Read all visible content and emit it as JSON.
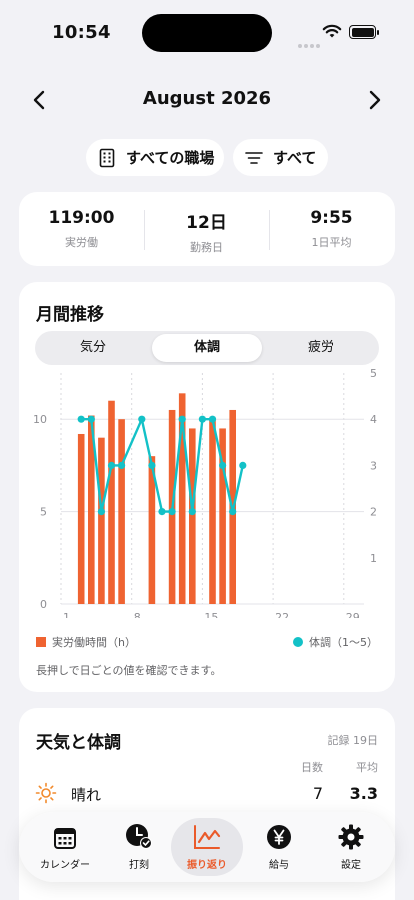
{
  "status": {
    "time": "10:54"
  },
  "header": {
    "month": "August 2026"
  },
  "filters": {
    "workplace": "すべての職場",
    "category": "すべて"
  },
  "summary": [
    {
      "value": "119:00",
      "label": "実労働"
    },
    {
      "value": "12日",
      "label": "勤務日"
    },
    {
      "value": "9:55",
      "label": "1日平均"
    }
  ],
  "trend": {
    "title": "月間推移",
    "segments": [
      "気分",
      "体調",
      "疲労"
    ],
    "selected_segment": "体調",
    "legend_hours": "実労働時間（h）",
    "legend_condition": "体調（1〜5）",
    "hint": "長押しで日ごとの値を確認できます。"
  },
  "colors": {
    "accent": "#ea5a2a",
    "bar": "#ef6331",
    "line": "#13c1c7"
  },
  "chart_data": {
    "type": "bar+line",
    "x": [
      3,
      4,
      5,
      6,
      7,
      9,
      10,
      11,
      12,
      13,
      14,
      15,
      16,
      17,
      18,
      19
    ],
    "x_ticks": [
      "1",
      "8",
      "15",
      "22",
      "29"
    ],
    "xlim": [
      1,
      31
    ],
    "series": [
      {
        "name": "実労働時間（h）",
        "type": "bar",
        "axis": "left",
        "values": [
          9.2,
          10.2,
          9.0,
          11.0,
          10.0,
          null,
          8.0,
          null,
          10.5,
          11.4,
          9.5,
          null,
          10.0,
          9.5,
          10.5,
          null
        ]
      },
      {
        "name": "体調（1〜5）",
        "type": "line",
        "axis": "right",
        "values": [
          4,
          4,
          2,
          3,
          3,
          4,
          3,
          2,
          2,
          4,
          2,
          4,
          4,
          3,
          2,
          3
        ]
      }
    ],
    "left_axis": {
      "ylim": [
        0,
        12.5
      ],
      "ticks": [
        "0",
        "5",
        "10"
      ]
    },
    "right_axis": {
      "ylim": [
        0,
        5
      ],
      "ticks": [
        "1",
        "2",
        "3",
        "4",
        "5"
      ]
    }
  },
  "weather": {
    "title": "天気と体調",
    "records": "記録 19日",
    "col_days": "日数",
    "col_avg": "平均",
    "rows": [
      {
        "icon": "sun-icon",
        "name": "晴れ",
        "days": "7",
        "avg": "3.3"
      }
    ]
  },
  "tabs": [
    {
      "icon": "calendar-icon",
      "label": "カレンダー"
    },
    {
      "icon": "clock-check-icon",
      "label": "打刻"
    },
    {
      "icon": "chart-line-icon",
      "label": "振り返り",
      "active": true
    },
    {
      "icon": "yen-icon",
      "label": "給与"
    },
    {
      "icon": "gear-icon",
      "label": "設定"
    }
  ]
}
